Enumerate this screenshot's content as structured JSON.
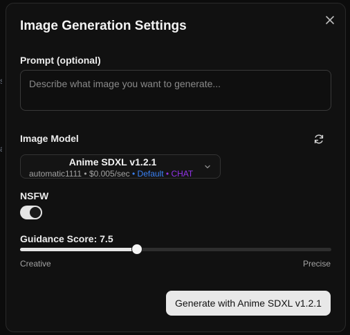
{
  "modal": {
    "title": "Image Generation Settings",
    "close_icon": "close-icon"
  },
  "background_edge": [
    "s",
    "a",
    "e"
  ],
  "prompt": {
    "label": "Prompt (optional)",
    "value": "",
    "placeholder": "Describe what image you want to generate..."
  },
  "model": {
    "label": "Image Model",
    "refresh_icon": "refresh-icon",
    "name": "Anime SDXL v1.2.1",
    "provider": "automatic1111",
    "sep1": " • ",
    "price": "$0.005/sec",
    "sep2": " • ",
    "default_tag": "Default",
    "sep3": " • ",
    "chat_tag": "CHAT",
    "default_color": "#3b82f6",
    "chat_color": "#9333ea"
  },
  "nsfw": {
    "label": "NSFW",
    "enabled": true
  },
  "guidance": {
    "label": "Guidance Score: 7.5",
    "value": 7.5,
    "min": 0,
    "max": 20,
    "min_label": "Creative",
    "max_label": "Precise"
  },
  "generate_button": {
    "label": "Generate with Anime SDXL v1.2.1"
  }
}
